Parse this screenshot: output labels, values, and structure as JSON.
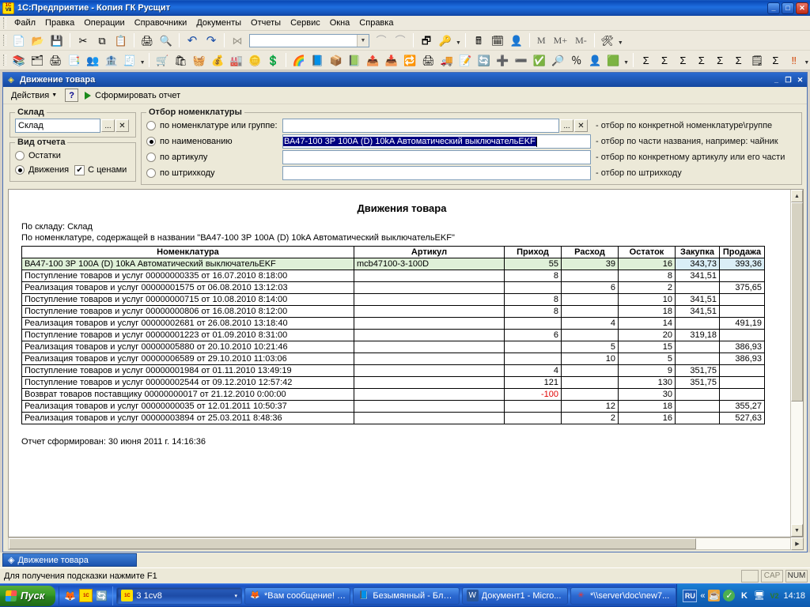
{
  "window": {
    "title": "1C:Предприятие - Копия ГК Русщит",
    "app_icon": "1c-logo-icon",
    "minimize": "_",
    "maximize": "□",
    "close": "✕"
  },
  "menu": {
    "items": [
      {
        "label": "Файл"
      },
      {
        "label": "Правка"
      },
      {
        "label": "Операции"
      },
      {
        "label": "Справочники"
      },
      {
        "label": "Документы"
      },
      {
        "label": "Отчеты"
      },
      {
        "label": "Сервис"
      },
      {
        "label": "Окна"
      },
      {
        "label": "Справка"
      }
    ]
  },
  "toolbar_top": {
    "icons": [
      "new-document-icon",
      "open-folder-icon",
      "save-icon",
      "cut-icon",
      "copy-icon",
      "paste-icon",
      "print-icon",
      "print-preview-icon",
      "undo-icon",
      "redo-icon",
      "find-icon"
    ],
    "combo_value": "",
    "icons_after": [
      "find-next-icon",
      "find-previous-icon",
      "window-list-icon",
      "1c-help-icon"
    ],
    "icons_tail": [
      "calculator-icon",
      "calendar-icon",
      "user-icon"
    ],
    "m_labels": [
      "M",
      "M+",
      "M-"
    ],
    "tools_icon": "tools-icon"
  },
  "toolbar_bottom": {
    "icons": [
      "books-icon",
      "catalog-icon",
      "reports-icon",
      "journal-icon",
      "persons-icon",
      "accounts-icon",
      "cash-register-icon",
      "buyer-icon",
      "supplier-icon",
      "client-icon",
      "money-icon",
      "warehouse-icon",
      "coin-out-icon",
      "coin-in-icon",
      "rainbow-icon",
      "doc-cart-icon",
      "goods-move-icon",
      "doc-buy-icon",
      "goods-out-icon",
      "goods-in-icon",
      "coins-exchange-icon",
      "doc-print-icon",
      "goods-ship-icon",
      "doc-edit-icon",
      "doc-refresh-icon",
      "add-coin-icon",
      "remove-coin-icon",
      "doc-check-icon",
      "coin-info-icon",
      "doc-percent-icon",
      "doc-person-icon",
      "excel-icon",
      "sum-report-icon",
      "sum-person-icon",
      "sum-group-icon",
      "sum-red-icon",
      "sum-flag-icon",
      "sum-mark-icon",
      "doc-copy-icon",
      "sum-check-icon",
      "warning-icon"
    ]
  },
  "document": {
    "title": "Движение товара",
    "title_icon": "report-window-icon",
    "actions_label": "Действия",
    "help_label": "?",
    "generate_label": "Сформировать отчет",
    "minimize": "_",
    "restore": "❐",
    "close": "✕"
  },
  "filters": {
    "warehouse": {
      "legend": "Склад",
      "value": "Склад",
      "select_button": "...",
      "clear_button": "✕"
    },
    "report_kind": {
      "legend": "Вид отчета",
      "options": [
        {
          "label": "Остатки",
          "selected": false
        },
        {
          "label": "Движения",
          "selected": true
        }
      ],
      "with_prices": {
        "label": "С ценами",
        "checked": true,
        "mark": "✔"
      }
    },
    "nomenclature": {
      "legend": "Отбор номенклатуры",
      "rows": [
        {
          "radio_label": "по номенклатуре или группе:",
          "selected": false,
          "value": "",
          "has_buttons": true,
          "select_button": "...",
          "clear_button": "✕",
          "hint": "- отбор по конкретной номенклатуре\\группе"
        },
        {
          "radio_label": "по наименованию",
          "selected": true,
          "value": "ВА47-100 3Р 100А (D) 10kA Автоматический выключательEKF",
          "has_buttons": false,
          "hint": "- отбор по части названия, например: чайник"
        },
        {
          "radio_label": "по артикулу",
          "selected": false,
          "value": "",
          "has_buttons": false,
          "hint": "- отбор по конкретному артикулу или его части"
        },
        {
          "radio_label": "по штрихкоду",
          "selected": false,
          "value": "",
          "has_buttons": false,
          "hint": "- отбор по штрихкоду"
        }
      ]
    }
  },
  "report": {
    "title": "Движения товара",
    "line_warehouse": "По складу: Склад",
    "line_filter": "По номенклатуре, содержащей в названии \"ВА47-100 3Р 100А (D) 10kA Автоматический выключательEKF\"",
    "footer": "Отчет сформирован: 30 июня 2011 г. 14:16:36",
    "columns": [
      "Номенклатура",
      "Артикул",
      "Приход",
      "Расход",
      "Остаток",
      "Закупка",
      "Продажа"
    ],
    "summary_row": {
      "name": "ВА47-100 3Р 100А (D) 10kA Автоматический выключательEKF",
      "article": "mcb47100-3-100D",
      "income": "55",
      "outcome": "39",
      "balance": "16",
      "buy": "343,73",
      "sell": "393,36"
    },
    "rows": [
      {
        "name": "Поступление товаров и услуг 00000000335 от 16.07.2010 8:18:00",
        "article": "",
        "income": "8",
        "outcome": "",
        "balance": "8",
        "buy": "341,51",
        "sell": "",
        "negative": false
      },
      {
        "name": "Реализация товаров и услуг 00000001575 от 06.08.2010 13:12:03",
        "article": "",
        "income": "",
        "outcome": "6",
        "balance": "2",
        "buy": "",
        "sell": "375,65",
        "negative": false
      },
      {
        "name": "Поступление товаров и услуг 00000000715 от 10.08.2010 8:14:00",
        "article": "",
        "income": "8",
        "outcome": "",
        "balance": "10",
        "buy": "341,51",
        "sell": "",
        "negative": false
      },
      {
        "name": "Поступление товаров и услуг 00000000806 от 16.08.2010 8:12:00",
        "article": "",
        "income": "8",
        "outcome": "",
        "balance": "18",
        "buy": "341,51",
        "sell": "",
        "negative": false
      },
      {
        "name": "Реализация товаров и услуг 00000002681 от 26.08.2010 13:18:40",
        "article": "",
        "income": "",
        "outcome": "4",
        "balance": "14",
        "buy": "",
        "sell": "491,19",
        "negative": false
      },
      {
        "name": "Поступление товаров и услуг 00000001223 от 01.09.2010 8:31:00",
        "article": "",
        "income": "6",
        "outcome": "",
        "balance": "20",
        "buy": "319,18",
        "sell": "",
        "negative": false
      },
      {
        "name": "Реализация товаров и услуг 00000005880 от 20.10.2010 10:21:46",
        "article": "",
        "income": "",
        "outcome": "5",
        "balance": "15",
        "buy": "",
        "sell": "386,93",
        "negative": false
      },
      {
        "name": "Реализация товаров и услуг 00000006589 от 29.10.2010 11:03:06",
        "article": "",
        "income": "",
        "outcome": "10",
        "balance": "5",
        "buy": "",
        "sell": "386,93",
        "negative": false
      },
      {
        "name": "Поступление товаров и услуг 00000001984 от 01.11.2010 13:49:19",
        "article": "",
        "income": "4",
        "outcome": "",
        "balance": "9",
        "buy": "351,75",
        "sell": "",
        "negative": false
      },
      {
        "name": "Поступление товаров и услуг 00000002544 от 09.12.2010 12:57:42",
        "article": "",
        "income": "121",
        "outcome": "",
        "balance": "130",
        "buy": "351,75",
        "sell": "",
        "negative": false
      },
      {
        "name": "Возврат товаров поставщику 00000000017 от 21.12.2010 0:00:00",
        "article": "",
        "income": "-100",
        "outcome": "",
        "balance": "30",
        "buy": "",
        "sell": "",
        "negative": true
      },
      {
        "name": "Реализация товаров и услуг 00000000035 от 12.01.2011 10:50:37",
        "article": "",
        "income": "",
        "outcome": "12",
        "balance": "18",
        "buy": "",
        "sell": "355,27",
        "negative": false
      },
      {
        "name": "Реализация товаров и услуг 00000003894 от 25.03.2011 8:48:36",
        "article": "",
        "income": "",
        "outcome": "2",
        "balance": "16",
        "buy": "",
        "sell": "527,63",
        "negative": false
      }
    ]
  },
  "window_list": {
    "tab_label": "Движение товара",
    "tab_icon": "report-window-icon"
  },
  "statusbar": {
    "hint": "Для получения подсказки нажмите F1",
    "cap": "CAP",
    "num": "NUM"
  },
  "taskbar": {
    "start_label": "Пуск",
    "quicklaunch": [
      "firefox-icon",
      "1c-icon",
      "refresh-icon"
    ],
    "tasks": [
      {
        "label": "3 1cv8",
        "icon": "1c-icon",
        "active": true,
        "has_dropdown": true,
        "dropdown": "▾"
      },
      {
        "label": "*Вам сообщение! -...",
        "icon": "firefox-icon",
        "active": false
      },
      {
        "label": "Безымянный - Бло...",
        "icon": "notepad-icon",
        "active": false
      },
      {
        "label": "Документ1 - Micro...",
        "icon": "word-icon",
        "active": false
      },
      {
        "label": "*\\\\server\\doc\\new7...",
        "icon": "editor-icon",
        "active": false
      }
    ],
    "tray": {
      "language": "RU",
      "expand": "«",
      "icons": [
        "java-icon",
        "shield-icon",
        "kaspersky-icon",
        "monitor-icon",
        "v2-icon"
      ],
      "clock": "14:18"
    }
  },
  "colors": {
    "title_blue": "#1550b4",
    "summary_green": "#dff0d8",
    "price_blue": "#daeef7",
    "buy_header": "#f8d9b0",
    "negative_red": "#e00000",
    "selection_navy": "#000080"
  }
}
